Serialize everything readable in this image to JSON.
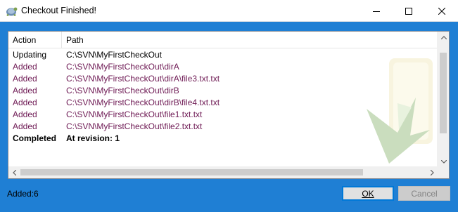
{
  "window": {
    "title": "Checkout Finished!",
    "icon": "tortoisesvn-icon"
  },
  "list": {
    "columns": [
      "Action",
      "Path"
    ],
    "rows": [
      {
        "action": "Updating",
        "path": "C:\\SVN\\MyFirstCheckOut",
        "kind": "updating"
      },
      {
        "action": "Added",
        "path": "C:\\SVN\\MyFirstCheckOut\\dirA",
        "kind": "added"
      },
      {
        "action": "Added",
        "path": "C:\\SVN\\MyFirstCheckOut\\dirA\\file3.txt.txt",
        "kind": "added"
      },
      {
        "action": "Added",
        "path": "C:\\SVN\\MyFirstCheckOut\\dirB",
        "kind": "added"
      },
      {
        "action": "Added",
        "path": "C:\\SVN\\MyFirstCheckOut\\dirB\\file4.txt.txt",
        "kind": "added"
      },
      {
        "action": "Added",
        "path": "C:\\SVN\\MyFirstCheckOut\\file1.txt.txt",
        "kind": "added"
      },
      {
        "action": "Added",
        "path": "C:\\SVN\\MyFirstCheckOut\\file2.txt.txt",
        "kind": "added"
      },
      {
        "action": "Completed",
        "path": "At revision: 1",
        "kind": "completed"
      }
    ]
  },
  "status": {
    "summary": "Added:6"
  },
  "buttons": {
    "ok": "OK",
    "cancel": "Cancel"
  },
  "colors": {
    "added": "#6e1a54",
    "background": "#1f7fd4",
    "ok_border": "#0078d7"
  }
}
